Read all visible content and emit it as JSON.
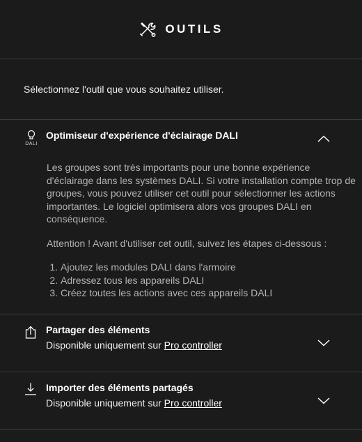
{
  "header": {
    "title": "OUTILS",
    "icon": "tools-icon"
  },
  "intro": "Sélectionnez l'outil que vous souhaitez utiliser.",
  "sections": [
    {
      "title": "Optimiseur d'expérience d'éclairage DALI",
      "icon": "dali-bulb-icon",
      "icon_label": "DALI",
      "expanded": true,
      "paragraph1": "Les groupes sont très importants pour une bonne expérience d'éclairage dans les systèmes DALI. Si votre installation compte trop de groupes, vous pouvez utiliser cet outil pour sélectionner les actions importantes. Le logiciel optimisera alors vos groupes DALI en conséquence.",
      "paragraph2": "Attention ! Avant d'utiliser cet outil, suivez les étapes ci-dessous :",
      "steps": [
        "Ajoutez les modules DALI dans l'armoire",
        "Adressez tous les appareils DALI",
        "Créez toutes les actions avec ces appareils DALI"
      ]
    },
    {
      "title": "Partager des éléments",
      "icon": "share-icon",
      "expanded": false,
      "availability_prefix": "Disponible uniquement sur",
      "availability_link": "Pro controller"
    },
    {
      "title": "Importer des éléments partagés",
      "icon": "download-icon",
      "expanded": false,
      "availability_prefix": "Disponible uniquement sur",
      "availability_link": "Pro controller"
    }
  ],
  "colors": {
    "background": "#1b1b1b",
    "divider": "#3c3c3c",
    "body_text": "#b4b4b4"
  }
}
